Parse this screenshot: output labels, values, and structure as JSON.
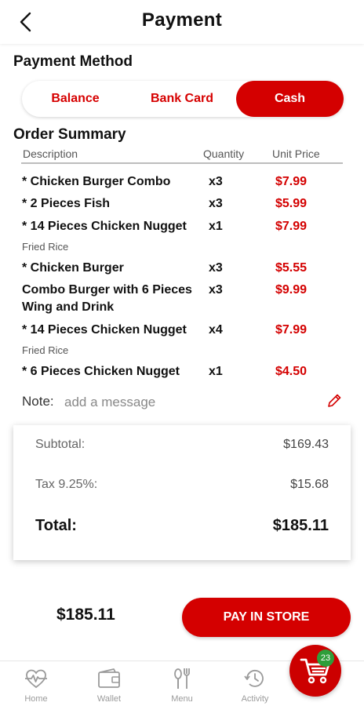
{
  "header": {
    "title": "Payment"
  },
  "payment_method": {
    "title": "Payment Method",
    "options": [
      "Balance",
      "Bank Card",
      "Cash"
    ],
    "selected": "Cash"
  },
  "order_summary": {
    "title": "Order Summary",
    "columns": {
      "description": "Description",
      "quantity": "Quantity",
      "unit_price": "Unit Price"
    },
    "items": [
      {
        "name": "* Chicken Burger Combo",
        "qty": "x3",
        "price": "$7.99"
      },
      {
        "name": "* 2 Pieces Fish",
        "qty": "x3",
        "price": "$5.99"
      },
      {
        "name": "* 14 Pieces Chicken Nugget",
        "qty": "x1",
        "price": "$7.99",
        "note": "Fried Rice"
      },
      {
        "name": "* Chicken Burger",
        "qty": "x3",
        "price": "$5.55"
      },
      {
        "name": "Combo Burger with 6 Pieces Wing and Drink",
        "qty": "x3",
        "price": "$9.99"
      },
      {
        "name": "* 14 Pieces Chicken Nugget",
        "qty": "x4",
        "price": "$7.99",
        "note": "Fried Rice"
      },
      {
        "name": "* 6 Pieces Chicken Nugget",
        "qty": "x1",
        "price": "$4.50"
      }
    ]
  },
  "note": {
    "label": "Note:",
    "placeholder": "add a message"
  },
  "summary": {
    "subtotal_label": "Subtotal:",
    "subtotal_value": "$169.43",
    "tax_label": "Tax 9.25%:",
    "tax_value": "$15.68",
    "total_label": "Total:",
    "total_value": "$185.11"
  },
  "footer": {
    "amount": "$185.11",
    "pay_label": "PAY IN STORE"
  },
  "tabbar": {
    "home": "Home",
    "wallet": "Wallet",
    "menu": "Menu",
    "activity": "Activity",
    "cart_count": "23"
  },
  "colors": {
    "accent": "#d40000",
    "badge": "#2e9e3a"
  }
}
